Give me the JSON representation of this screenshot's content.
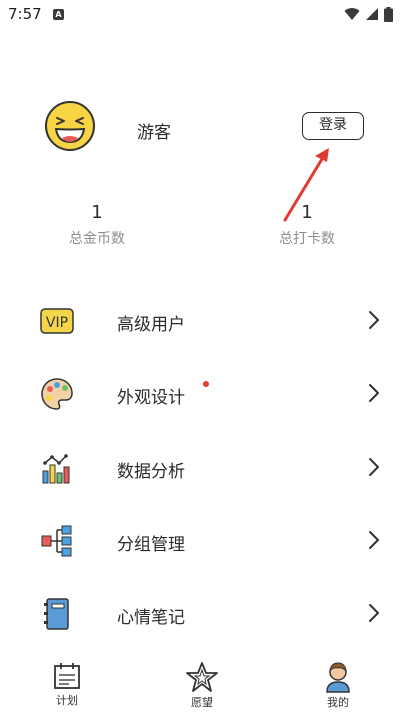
{
  "status": {
    "time": "7:57",
    "app_badge": "A"
  },
  "profile": {
    "username": "游客",
    "login_label": "登录"
  },
  "stats": [
    {
      "value": "1",
      "label": "总金币数"
    },
    {
      "value": "1",
      "label": "总打卡数"
    }
  ],
  "menu": [
    {
      "label": "高级用户",
      "icon": "vip-icon"
    },
    {
      "label": "外观设计",
      "icon": "palette-icon"
    },
    {
      "label": "数据分析",
      "icon": "bar-chart-icon"
    },
    {
      "label": "分组管理",
      "icon": "hierarchy-icon"
    },
    {
      "label": "心情笔记",
      "icon": "notebook-icon"
    }
  ],
  "tabs": [
    {
      "label": "计划",
      "icon": "calendar-icon"
    },
    {
      "label": "愿望",
      "icon": "star-icon"
    },
    {
      "label": "我的",
      "icon": "user-icon"
    }
  ],
  "colors": {
    "accent_red": "#e53935",
    "vip_yellow": "#f5d64a"
  }
}
